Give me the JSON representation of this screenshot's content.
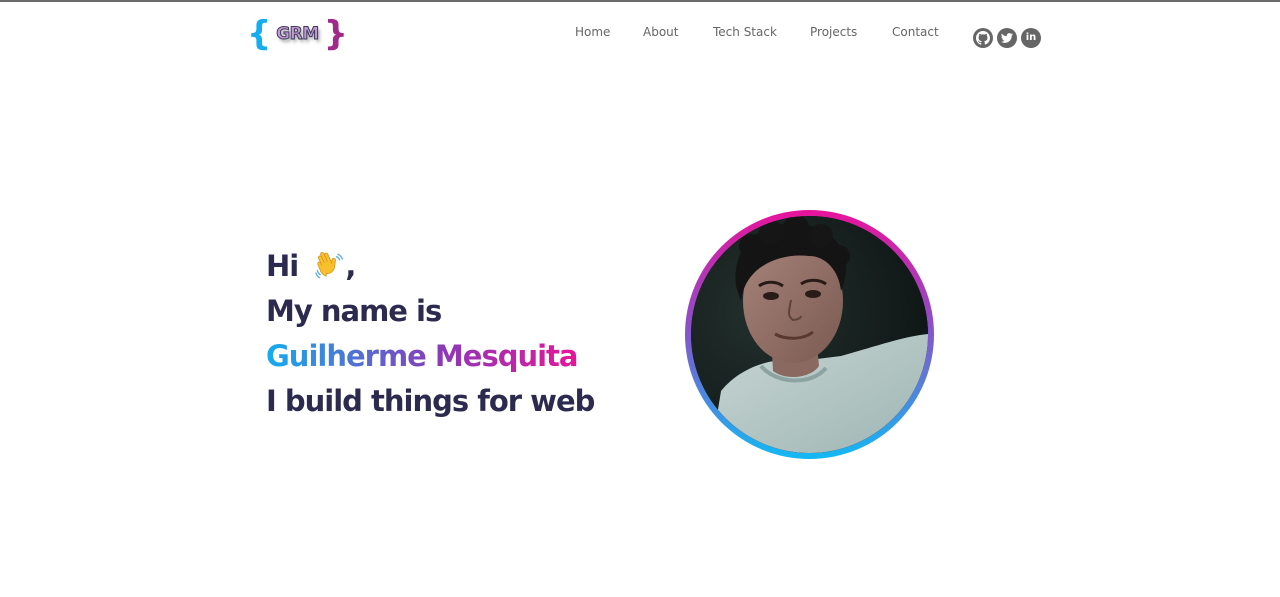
{
  "logo": {
    "brace_open": "{",
    "text": "GRM",
    "brace_close": "}"
  },
  "nav": {
    "items": [
      {
        "label": "Home"
      },
      {
        "label": "About"
      },
      {
        "label": "Tech Stack"
      },
      {
        "label": "Projects"
      },
      {
        "label": "Contact"
      }
    ]
  },
  "socials": [
    {
      "icon": "github-icon"
    },
    {
      "icon": "twitter-icon"
    },
    {
      "icon": "linkedin-icon",
      "text": "in"
    }
  ],
  "hero": {
    "greeting": "Hi",
    "comma": ",",
    "line2": "My name is",
    "name": "Guilherme Mesquita",
    "line4": "I build things for web"
  },
  "colors": {
    "text_dark": "#2c2b4f",
    "nav_text": "#666666",
    "gradient_blue": "#13adf0",
    "gradient_purple": "#8a3ab9",
    "gradient_pink": "#e7159a"
  }
}
